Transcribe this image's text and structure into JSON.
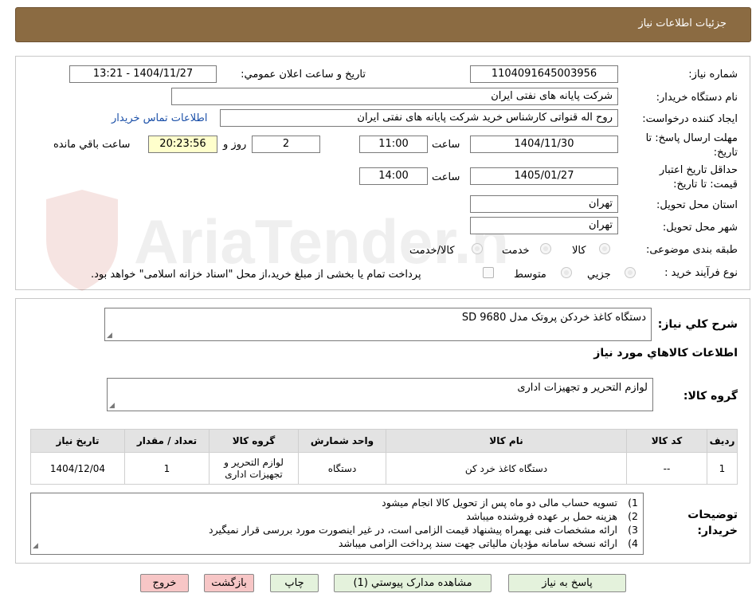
{
  "header": {
    "title": "جزئیات اطلاعات نیاز"
  },
  "watermark": {
    "text": "AriaTender.neT"
  },
  "form": {
    "need_number": {
      "label": "شماره نیاز:",
      "value": "1104091645003956"
    },
    "announce": {
      "label": "تاریخ و ساعت اعلان عمومي:",
      "value": "1404/11/27 - 13:21"
    },
    "buyer_org": {
      "label": "نام دستگاه خریدار:",
      "value": "شرکت پایانه های نفتی ایران"
    },
    "requester": {
      "label": "ایجاد کننده درخواست:",
      "value": "روح اله قنواتی کارشناس خرید شرکت پایانه های نفتی ایران",
      "contact_link": "اطلاعات تماس خریدار"
    },
    "deadline": {
      "label_line1": "مهلت ارسال پاسخ: تا",
      "label_line2": "تاریخ:",
      "date": "1404/11/30",
      "time_label": "ساعت",
      "time": "11:00",
      "days": "2",
      "days_label": "روز و",
      "remaining": "20:23:56",
      "remaining_label": "ساعت باقي مانده"
    },
    "validity": {
      "label_line1": "حداقل تاریخ اعتبار",
      "label_line2": "قیمت: تا تاریخ:",
      "date": "1405/01/27",
      "time_label": "ساعت",
      "time": "14:00"
    },
    "province": {
      "label": "استان محل تحویل:",
      "value": "تهران"
    },
    "city": {
      "label": "شهر محل تحویل:",
      "value": "تهران"
    },
    "category": {
      "label": "طبقه بندی موضوعی:",
      "options": [
        "کالا",
        "خدمت",
        "کالا/خدمت"
      ]
    },
    "purchase_type": {
      "label": "نوع فرآیند خرید :",
      "options": [
        "جزیي",
        "متوسط"
      ],
      "note": "پرداخت تمام یا بخشی از مبلغ خرید،از محل \"اسناد خزانه اسلامی\" خواهد بود."
    }
  },
  "summary": {
    "label": "شرح كلي نياز:",
    "value": "دستگاه کاغذ خردکن پروتک مدل SD 9680"
  },
  "goods_info": {
    "title": "اطلاعات كالاهاي مورد نياز"
  },
  "goods_group": {
    "label": "گروه کالا:",
    "value": "لوازم التحریر و تجهیزات اداری"
  },
  "table": {
    "headers": [
      "رديف",
      "کد کالا",
      "نام کالا",
      "واحد شمارش",
      "گروه کالا",
      "تعداد / مقدار",
      "تاریخ نیاز"
    ],
    "rows": [
      [
        "1",
        "--",
        "دستگاه کاغذ خرد کن",
        "دستگاه",
        "لوازم التحریر و تجهیزات اداری",
        "1",
        "1404/12/04"
      ]
    ]
  },
  "buyer_notes": {
    "label_line1": "توضیحات",
    "label_line2": "خریدار:",
    "items": [
      {
        "num": "1)",
        "text": "تسویه حساب مالی دو ماه پس از تحویل کالا انجام میشود"
      },
      {
        "num": "2)",
        "text": "هزینه حمل بر عهده فروشنده میباشد"
      },
      {
        "num": "3)",
        "text": "ارائه مشخصات فنی بهمراه پیشنهاد قیمت الزامی است، در غیر اینصورت مورد بررسی قرار نمیگیرد"
      },
      {
        "num": "4)",
        "text": "ارائه نسخه سامانه مؤدیان مالیاتی جهت سند پرداخت الزامی میباشد"
      }
    ]
  },
  "buttons": {
    "reply": "پاسخ به نياز",
    "attachments": "مشاهده مدارک پیوستي (1)",
    "print": "چاپ",
    "back": "بازگشت",
    "exit": "خروج"
  },
  "colors": {
    "header_bg": "#8b6b42",
    "yellow_field": "#ffffcc",
    "green_button": "#e4f2dc",
    "pink_button": "#f7c6c6",
    "link": "#1a4fa8"
  }
}
